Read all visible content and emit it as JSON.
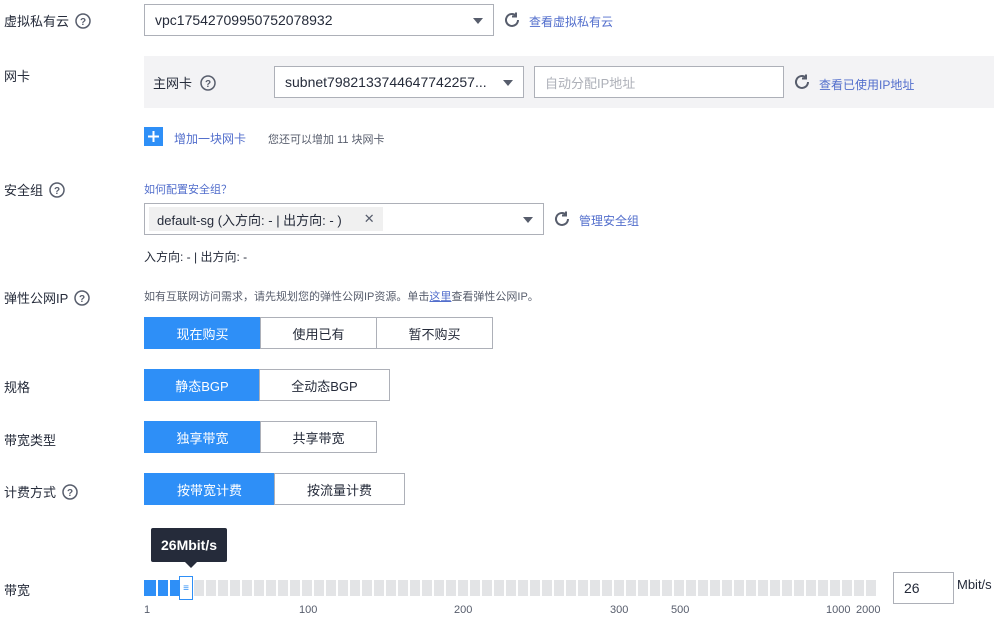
{
  "vpc": {
    "label": "虚拟私有云",
    "value": "vpc1754270995075207893​2",
    "link": "查看虚拟私有云"
  },
  "nic": {
    "label": "网卡",
    "primary_label": "主网卡",
    "subnet_value": "subnet798213374464774225​7...",
    "ip_placeholder": "自动分配IP地址",
    "link": "查看已使用IP地址",
    "add_label": "增加一块网卡",
    "add_hint": "您还可以增加 11 块网卡"
  },
  "security_group": {
    "label": "安全组",
    "help_link": "如何配置安全组？",
    "tag": "default-sg (入方向: - | 出方向: - )",
    "manage_link": "管理安全组",
    "summary": "入方向: - | 出方向: -"
  },
  "eip": {
    "label": "弹性公网IP",
    "hint_prefix": "如有互联网访问需求，请先规划您的弹性公网IP资源。单击",
    "hint_link": "这里",
    "hint_suffix": "查看弹性公网IP。",
    "options": [
      "现在购买",
      "使用已有",
      "暂不购买"
    ],
    "selected": 0
  },
  "spec": {
    "label": "规格",
    "options": [
      "静态BGP",
      "全动态BGP"
    ],
    "selected": 0
  },
  "bandwidth_type": {
    "label": "带宽类型",
    "options": [
      "独享带宽",
      "共享带宽"
    ],
    "selected": 0
  },
  "billing": {
    "label": "计费方式",
    "options": [
      "按带宽计费",
      "按流量计费"
    ],
    "selected": 0
  },
  "bandwidth": {
    "label": "带宽",
    "tooltip": "26Mbit/s",
    "value": "26",
    "unit": "Mbit/s",
    "ticks": [
      "1",
      "100",
      "200",
      "300",
      "500",
      "1000",
      "2000"
    ],
    "fill_fraction": 0.057
  },
  "colors": {
    "primary": "#2e8ff7",
    "link": "#526ecc",
    "border": "#adb0b8"
  }
}
